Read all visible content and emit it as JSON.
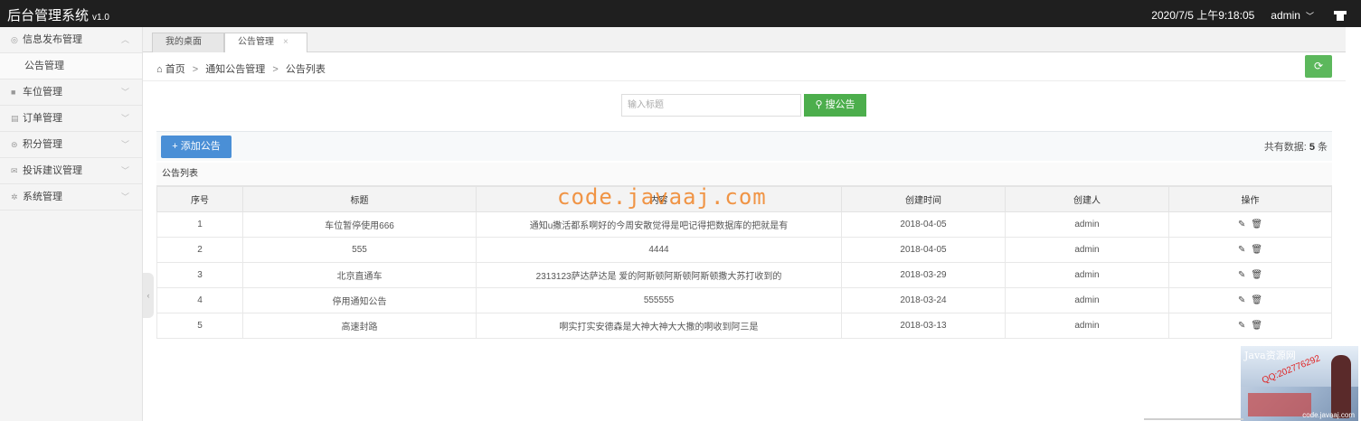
{
  "header": {
    "title": "后台管理系统",
    "version": "v1.0",
    "datetime": "2020/7/5 上午9:18:05",
    "user": "admin",
    "chevron_icon": "chevron-down-icon",
    "shirt_icon": "shirt-icon"
  },
  "sidebar": {
    "items": [
      {
        "label": "信息发布管理",
        "icon": "message-icon",
        "arrow": "︿"
      },
      {
        "label": "公告管理",
        "icon": "",
        "arrow": ""
      },
      {
        "label": "车位管理",
        "icon": "car-icon",
        "arrow": "﹀"
      },
      {
        "label": "订单管理",
        "icon": "order-icon",
        "arrow": "﹀"
      },
      {
        "label": "积分管理",
        "icon": "points-icon",
        "arrow": "﹀"
      },
      {
        "label": "投诉建议管理",
        "icon": "mail-icon",
        "arrow": "﹀"
      },
      {
        "label": "系统管理",
        "icon": "gear-icon",
        "arrow": "﹀"
      }
    ]
  },
  "tabs": [
    {
      "label": "我的桌面"
    },
    {
      "label": "公告管理",
      "close": "×"
    }
  ],
  "breadcrumb": {
    "home": "首页",
    "level1": "通知公告管理",
    "level2": "公告列表",
    "sep": ">"
  },
  "search": {
    "placeholder": "输入标题",
    "button": "搜公告"
  },
  "toolbar": {
    "add_label": "添加公告",
    "total_prefix": "共有数据:",
    "total_count": "5",
    "total_suffix": "条"
  },
  "list_title": "公告列表",
  "table": {
    "headers": [
      "序号",
      "标题",
      "内容",
      "创建时间",
      "创建人",
      "操作"
    ],
    "rows": [
      [
        "1",
        "车位暂停使用666",
        "通知u撒活都系啊好的今周安散觉得是吧记得把数据库的把就是有",
        "2018-04-05",
        "admin"
      ],
      [
        "2",
        "555",
        "4444",
        "2018-04-05",
        "admin"
      ],
      [
        "3",
        "北京直通车",
        "2313123萨达萨达是 爱的阿斯顿阿斯顿阿斯顿撒大苏打收到的",
        "2018-03-29",
        "admin"
      ],
      [
        "4",
        "停用通知公告",
        "555555",
        "2018-03-24",
        "admin"
      ],
      [
        "5",
        "高速封路",
        "啊实打实安德森是大神大神大大撒的啊收到阿三是",
        "2018-03-13",
        "admin"
      ]
    ]
  },
  "watermark": "code.javaaj.com",
  "ad": {
    "title": "Java资源网",
    "qq": "QQ:202776292",
    "site": "code.javaaj.com"
  },
  "colors": {
    "topbar": "#1f1f1f",
    "green": "#5cb85c",
    "blue": "#4a8fd6",
    "watermark": "#ee8226"
  }
}
